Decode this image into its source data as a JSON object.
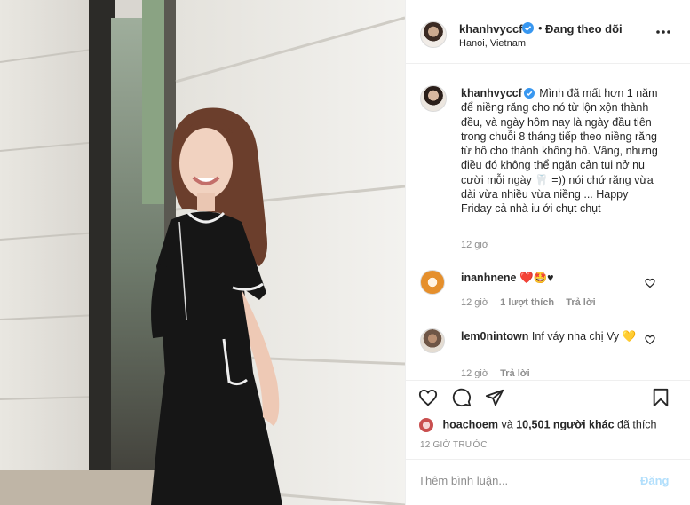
{
  "header": {
    "username": "khanhvyccf",
    "separator": "•",
    "follow_status": "Đang theo dõi",
    "location": "Hanoi, Vietnam"
  },
  "caption": {
    "username": "khanhvyccf",
    "text": "Mình đã mất hơn 1 năm để niềng răng cho nó từ lộn xộn thành đều, và ngày hôm nay là ngày đầu tiên trong chuỗi 8 tháng tiếp theo niềng răng từ hô cho thành không hô. Vâng, nhưng điều đó không thể ngăn cản tui nở nụ cười mỗi ngày 🦷 =)) nói chứ răng vừa dài vừa nhiều vừa niềng ... Happy Friday cả nhà iu ới chụt chụt",
    "time": "12 giờ"
  },
  "comments": [
    {
      "username": "inanhnene",
      "text": "❤️🤩♥",
      "time": "12 giờ",
      "likes": "1 lượt thích",
      "reply": "Trả lời"
    },
    {
      "username": "lem0nintown",
      "text": "Inf váy nha chị Vy 💛",
      "time": "12 giờ",
      "reply": "Trả lời"
    }
  ],
  "likes": {
    "liker": "hoachoem",
    "and": "và",
    "others": "10,501 người khác",
    "suffix": "đã thích"
  },
  "post_time": "12 GIỜ TRƯỚC",
  "add_comment": {
    "placeholder": "Thêm bình luận...",
    "post_label": "Đăng"
  },
  "icons": {
    "verified": "verified-badge-icon",
    "more": "more-options-icon",
    "like": "heart-icon",
    "comment": "comment-icon",
    "share": "share-icon",
    "save": "bookmark-icon"
  },
  "colors": {
    "verified_blue": "#3897f0",
    "post_button_disabled": "#b2dffc",
    "muted_text": "#8e8e8e"
  }
}
